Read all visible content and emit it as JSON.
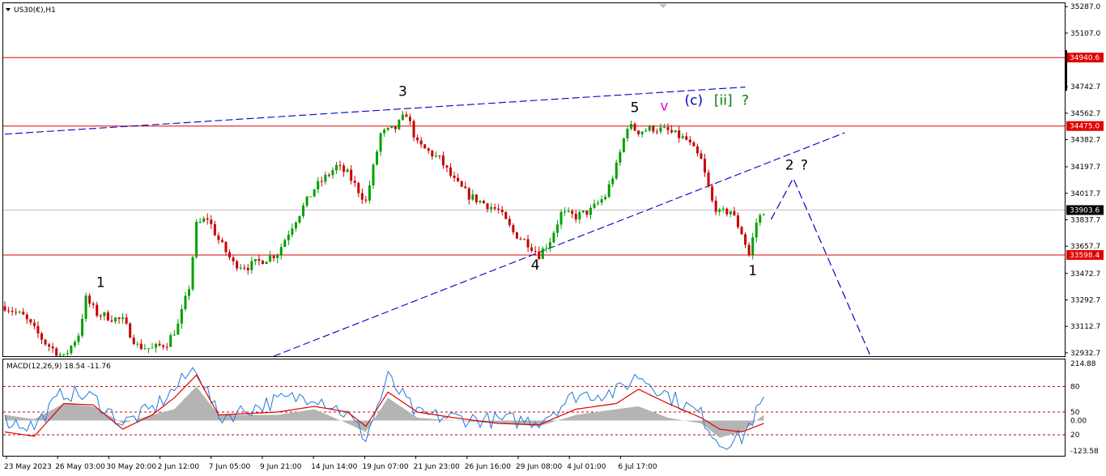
{
  "header": {
    "symbol": "US30(€),H1",
    "indicator_label": "MACD(12,26,9) 18.54 -11.76"
  },
  "colors": {
    "background": "#ffffff",
    "candle_up": "#00a000",
    "candle_down": "#c80000",
    "hline": "#e00000",
    "trendline": "#0000c8",
    "macd_hist": "#b4b4b4",
    "macd_line": "#1e78dc",
    "signal_line": "#dc0000",
    "level_dotted": "#c80000",
    "price_tag_bg": "#e00000",
    "current_tag_bg": "#000000"
  },
  "chart_data": [
    {
      "type": "candlestick",
      "title": "US30(€),H1",
      "x_tick_labels": [
        "23 May 2023",
        "26 May 03:00",
        "30 May 20:00",
        "2 Jun 12:00",
        "7 Jun 05:00",
        "9 Jun 21:00",
        "14 Jun 14:00",
        "19 Jun 07:00",
        "21 Jun 23:00",
        "26 Jun 16:00",
        "29 Jun 08:00",
        "4 Jul 01:00",
        "6 Jul 17:00"
      ],
      "y_tick_labels": [
        "35287.0",
        "35107.0",
        "34742.7",
        "34562.7",
        "34382.7",
        "34197.7",
        "34017.7",
        "33837.7",
        "33657.7",
        "33472.7",
        "33292.7",
        "33112.7",
        "32932.7"
      ],
      "ylim": [
        32910,
        35310
      ],
      "current_price": "33903.6",
      "horizontal_levels": [
        "34940.6",
        "34475.0",
        "33598.4"
      ],
      "price_path": [
        {
          "i": 0,
          "p": 33250
        },
        {
          "i": 5,
          "p": 33180
        },
        {
          "i": 11,
          "p": 33000
        },
        {
          "i": 16,
          "p": 32900
        },
        {
          "i": 20,
          "p": 33060
        },
        {
          "i": 22,
          "p": 33300
        },
        {
          "i": 25,
          "p": 33200
        },
        {
          "i": 32,
          "p": 33150
        },
        {
          "i": 36,
          "p": 32980
        },
        {
          "i": 40,
          "p": 32960
        },
        {
          "i": 44,
          "p": 33000
        },
        {
          "i": 47,
          "p": 33120
        },
        {
          "i": 50,
          "p": 33380
        },
        {
          "i": 52,
          "p": 33800
        },
        {
          "i": 55,
          "p": 33850
        },
        {
          "i": 58,
          "p": 33700
        },
        {
          "i": 62,
          "p": 33540
        },
        {
          "i": 66,
          "p": 33520
        },
        {
          "i": 74,
          "p": 33610
        },
        {
          "i": 78,
          "p": 33800
        },
        {
          "i": 84,
          "p": 34050
        },
        {
          "i": 90,
          "p": 34200
        },
        {
          "i": 93,
          "p": 34150
        },
        {
          "i": 98,
          "p": 33960
        },
        {
          "i": 102,
          "p": 34420
        },
        {
          "i": 106,
          "p": 34460
        },
        {
          "i": 109,
          "p": 34560
        },
        {
          "i": 112,
          "p": 34350
        },
        {
          "i": 118,
          "p": 34250
        },
        {
          "i": 122,
          "p": 34100
        },
        {
          "i": 126,
          "p": 34000
        },
        {
          "i": 130,
          "p": 33950
        },
        {
          "i": 134,
          "p": 33900
        },
        {
          "i": 138,
          "p": 33750
        },
        {
          "i": 142,
          "p": 33680
        },
        {
          "i": 145,
          "p": 33600
        },
        {
          "i": 148,
          "p": 33700
        },
        {
          "i": 151,
          "p": 33880
        },
        {
          "i": 155,
          "p": 33860
        },
        {
          "i": 159,
          "p": 33900
        },
        {
          "i": 163,
          "p": 34000
        },
        {
          "i": 166,
          "p": 34200
        },
        {
          "i": 169,
          "p": 34480
        },
        {
          "i": 172,
          "p": 34440
        },
        {
          "i": 176,
          "p": 34460
        },
        {
          "i": 180,
          "p": 34440
        },
        {
          "i": 185,
          "p": 34380
        },
        {
          "i": 189,
          "p": 34240
        },
        {
          "i": 192,
          "p": 33960
        },
        {
          "i": 194,
          "p": 33880
        },
        {
          "i": 197,
          "p": 33900
        },
        {
          "i": 200,
          "p": 33750
        },
        {
          "i": 202,
          "p": 33600
        },
        {
          "i": 204,
          "p": 33820
        },
        {
          "i": 206,
          "p": 33900
        }
      ],
      "indicator": {
        "name": "MACD(12,26,9)",
        "main_value": "18.54",
        "signal_value": "-11.76",
        "y_tick_labels": [
          "214.88",
          "80",
          "50",
          "0.00",
          "20",
          "-123.58"
        ],
        "ylim": [
          -123.58,
          214.88
        ],
        "dotted_levels": [
          120,
          30,
          -50
        ],
        "series": [
          {
            "i": 0,
            "hist": 20,
            "macd": 0,
            "signal": -40
          },
          {
            "i": 8,
            "hist": 5,
            "macd": -20,
            "signal": -55
          },
          {
            "i": 16,
            "hist": 60,
            "macd": 100,
            "signal": 60
          },
          {
            "i": 24,
            "hist": 50,
            "macd": 80,
            "signal": 55
          },
          {
            "i": 32,
            "hist": -10,
            "macd": -10,
            "signal": -30
          },
          {
            "i": 40,
            "hist": 20,
            "macd": 40,
            "signal": 20
          },
          {
            "i": 46,
            "hist": 40,
            "macd": 110,
            "signal": 80
          },
          {
            "i": 52,
            "hist": 120,
            "macd": 190,
            "signal": 160
          },
          {
            "i": 58,
            "hist": 20,
            "macd": 10,
            "signal": 20
          },
          {
            "i": 66,
            "hist": 20,
            "macd": 40,
            "signal": 25
          },
          {
            "i": 74,
            "hist": 20,
            "macd": 70,
            "signal": 30
          },
          {
            "i": 84,
            "hist": 40,
            "macd": 90,
            "signal": 50
          },
          {
            "i": 93,
            "hist": -10,
            "macd": 20,
            "signal": 30
          },
          {
            "i": 98,
            "hist": -40,
            "macd": -60,
            "signal": -20
          },
          {
            "i": 104,
            "hist": 80,
            "macd": 150,
            "signal": 100
          },
          {
            "i": 112,
            "hist": 10,
            "macd": 20,
            "signal": 30
          },
          {
            "i": 122,
            "hist": 0,
            "macd": 10,
            "signal": 10
          },
          {
            "i": 134,
            "hist": -10,
            "macd": 0,
            "signal": -10
          },
          {
            "i": 145,
            "hist": -20,
            "macd": 0,
            "signal": -15
          },
          {
            "i": 155,
            "hist": 20,
            "macd": 90,
            "signal": 40
          },
          {
            "i": 166,
            "hist": 40,
            "macd": 100,
            "signal": 60
          },
          {
            "i": 172,
            "hist": 50,
            "macd": 160,
            "signal": 110
          },
          {
            "i": 180,
            "hist": 10,
            "macd": 90,
            "signal": 60
          },
          {
            "i": 189,
            "hist": -10,
            "macd": 20,
            "signal": 10
          },
          {
            "i": 194,
            "hist": -60,
            "macd": -80,
            "signal": -30
          },
          {
            "i": 200,
            "hist": -40,
            "macd": -60,
            "signal": -40
          },
          {
            "i": 206,
            "hist": 20,
            "macd": 70,
            "signal": -10
          }
        ]
      },
      "wave_labels": [
        {
          "text": "1",
          "i": 26,
          "p": 33380,
          "color": "#000000"
        },
        {
          "text": "3",
          "i": 108,
          "p": 34680,
          "color": "#000000"
        },
        {
          "text": "4",
          "i": 144,
          "p": 33500,
          "color": "#000000"
        },
        {
          "text": "5",
          "i": 171,
          "p": 34570,
          "color": "#000000"
        },
        {
          "text": "v",
          "i": 179,
          "p": 34580,
          "color": "#e000e0"
        },
        {
          "text": "(c)",
          "i": 187,
          "p": 34620,
          "color": "#0000c8"
        },
        {
          "text": "[ii]",
          "i": 195,
          "p": 34620,
          "color": "#008000"
        },
        {
          "text": "?",
          "i": 201,
          "p": 34620,
          "color": "#008000"
        },
        {
          "text": "1",
          "i": 203,
          "p": 33460,
          "color": "#000000"
        },
        {
          "text": "2",
          "i": 213,
          "p": 34180,
          "color": "#000000"
        },
        {
          "text": "?",
          "i": 217,
          "p": 34180,
          "color": "#000000"
        }
      ],
      "trendlines": [
        {
          "from": {
            "i": 0,
            "p": 34420
          },
          "to": {
            "i": 201,
            "p": 34740
          },
          "style": "dashed"
        },
        {
          "from": {
            "i": 73,
            "p": 32910
          },
          "to": {
            "i": 228,
            "p": 34430
          },
          "style": "dashed"
        }
      ],
      "projection": [
        {
          "i": 208,
          "p": 33840
        },
        {
          "i": 214,
          "p": 34120
        },
        {
          "i": 235,
          "p": 32910
        }
      ]
    }
  ]
}
